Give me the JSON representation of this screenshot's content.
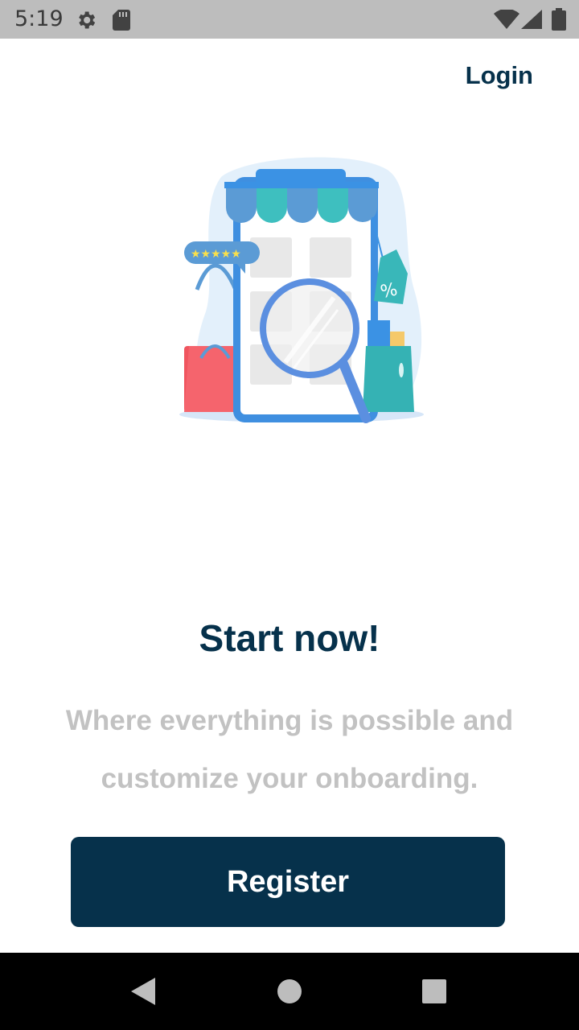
{
  "status_bar": {
    "time": "5:19",
    "icons": [
      "gear-icon",
      "sd-card-icon",
      "wifi-icon",
      "signal-icon",
      "battery-icon"
    ]
  },
  "header": {
    "login_label": "Login"
  },
  "hero": {
    "illustration": "shop-search-illustration"
  },
  "main": {
    "headline": "Start now!",
    "subtitle": "Where everything is possible and customize your onboarding."
  },
  "actions": {
    "register_label": "Register"
  },
  "nav_bar": {
    "icons": [
      "back-icon",
      "home-icon",
      "recents-icon"
    ]
  },
  "colors": {
    "primary": "#06314b",
    "subtitle_gray": "#c2c2c2",
    "status_bar": "#bdbdbd",
    "nav_bar": "#000000"
  }
}
